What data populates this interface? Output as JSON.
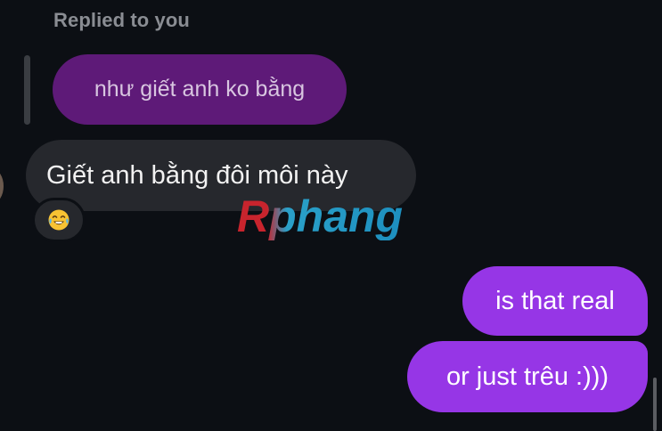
{
  "thread": {
    "replied_label": "Replied to you",
    "quoted_message": "như giết anh ko bằng",
    "incoming_message": "Giết anh bằng đôi môi này",
    "reaction_icon": "face-with-tears-of-joy-icon",
    "watermark_text": "Rphang",
    "outgoing_messages": [
      "is that real",
      "or just trêu :)))"
    ]
  },
  "colors": {
    "background": "#0c0f14",
    "quoted_bubble": "#5e1a78",
    "incoming_bubble": "#26282d",
    "outgoing_bubble": "#9636e6",
    "watermark_red": "#c8242d",
    "watermark_cyan": "#2aa0c8"
  }
}
